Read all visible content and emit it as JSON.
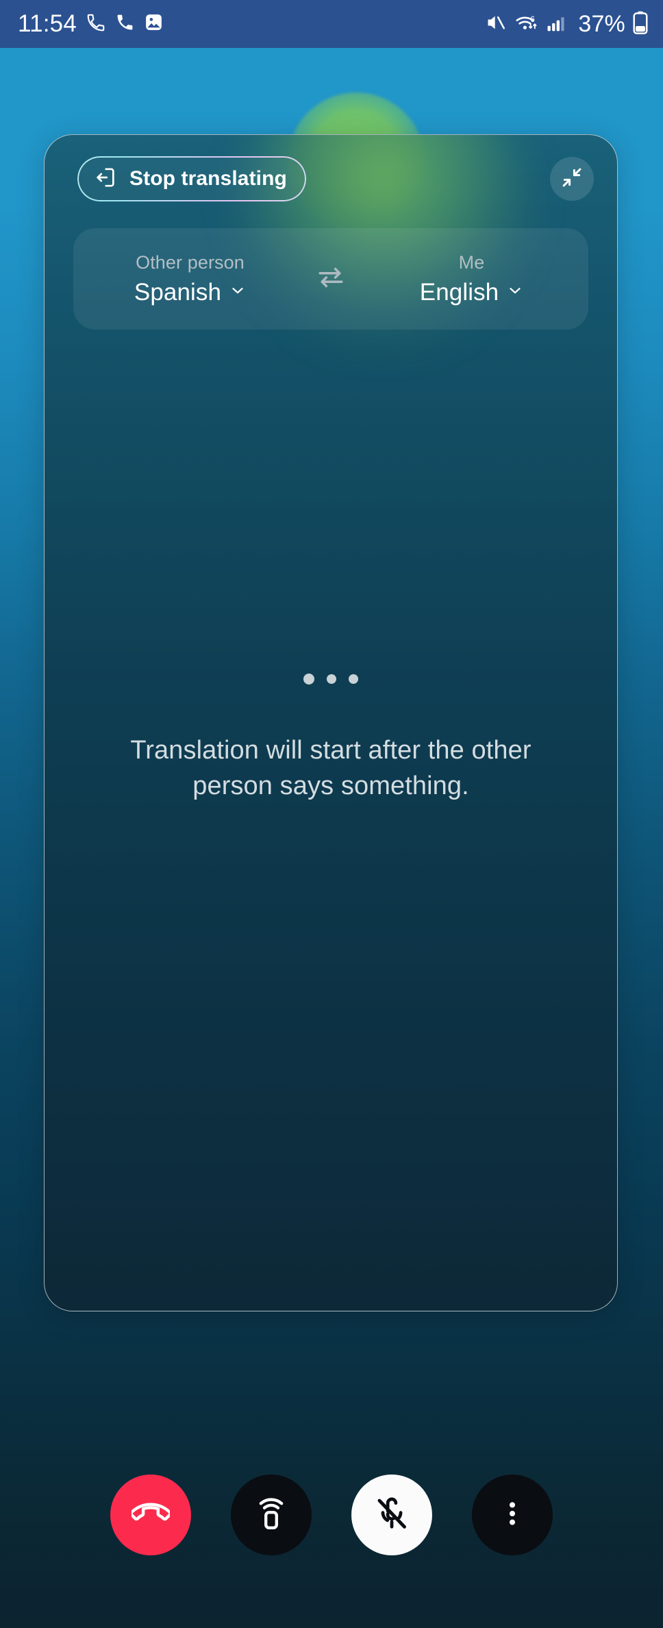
{
  "status_bar": {
    "time": "11:54",
    "battery_percent": "37%",
    "left_icons": [
      "call-forwarding-icon",
      "phone-call-icon",
      "image-icon"
    ],
    "right_icons": [
      "mute-icon",
      "wifi-6-icon",
      "cellular-signal-icon",
      "battery-icon"
    ],
    "background_color": "#2b5191"
  },
  "card": {
    "stop_button": {
      "label": "Stop translating",
      "icon": "exit-icon"
    },
    "collapse_button": {
      "icon": "collapse-arrows-icon"
    },
    "language_selector": {
      "other": {
        "role_label": "Other person",
        "language": "Spanish",
        "chevron": "chevron-down-icon"
      },
      "me": {
        "role_label": "Me",
        "language": "English",
        "chevron": "chevron-down-icon"
      },
      "swap_icon": "swap-arrows-icon"
    },
    "empty_state": {
      "dots": "typing-indicator",
      "message": "Translation will start after the other person says something."
    }
  },
  "call_controls": [
    {
      "name": "end-call-button",
      "icon": "phone-hangup-icon",
      "color": "#fc2b4e",
      "state": "default"
    },
    {
      "name": "speaker-button",
      "icon": "speaker-phone-icon",
      "color": "#0a0d12",
      "state": "default"
    },
    {
      "name": "mute-button",
      "icon": "microphone-off-icon",
      "color": "#fbfbfb",
      "state": "active"
    },
    {
      "name": "more-options-button",
      "icon": "overflow-menu-icon",
      "color": "#0a0d12",
      "state": "default"
    }
  ],
  "theme": {
    "background_top": "#2196c9",
    "background_bottom": "#0c2330",
    "accent_glow": "#7cc95c",
    "card_border": "rgba(222,230,235,0.72)"
  }
}
